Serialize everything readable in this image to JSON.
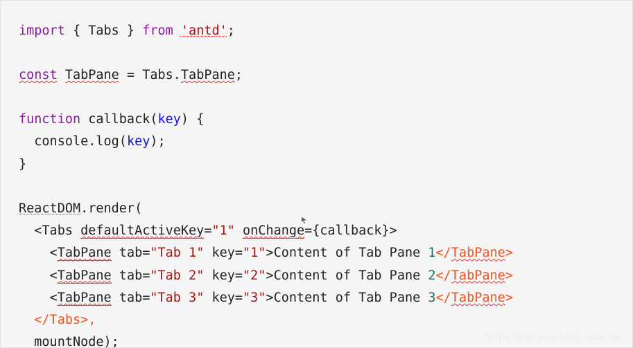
{
  "editor": {
    "background_color": "#f5f5f5",
    "border_color": "#e0e0e0",
    "font_family_kind": "monospace",
    "colors": {
      "plain": "#222222",
      "keyword": "#8b1a9e",
      "string": "#aa1111",
      "parameter": "#1414d6",
      "closing_tag": "#f4511e",
      "number": "#17705e",
      "spellcheck_squiggle": "#e03030",
      "watermark": "#ececec"
    },
    "language": "jsx"
  },
  "code": {
    "full_text": "import { Tabs } from 'antd';\n\nconst TabPane = Tabs.TabPane;\n\nfunction callback(key) {\n  console.log(key);\n}\n\nReactDOM.render(\n  <Tabs defaultActiveKey=\"1\" onChange={callback}>\n    <TabPane tab=\"Tab 1\" key=\"1\">Content of Tab Pane 1</TabPane>\n    <TabPane tab=\"Tab 2\" key=\"2\">Content of Tab Pane 2</TabPane>\n    <TabPane tab=\"Tab 3\" key=\"3\">Content of Tab Pane 3</TabPane>\n  </Tabs>,\n  mountNode);",
    "lines": [
      {
        "n": 1,
        "tokens": [
          {
            "t": "import",
            "c": "keyword"
          },
          {
            "t": " { Tabs } ",
            "c": "plain"
          },
          {
            "t": "from",
            "c": "keyword"
          },
          {
            "t": " ",
            "c": "plain"
          },
          {
            "t": "'antd'",
            "c": "string",
            "u": "dotted"
          },
          {
            "t": ";",
            "c": "plain"
          }
        ]
      },
      {
        "n": 2,
        "tokens": []
      },
      {
        "n": 3,
        "tokens": [
          {
            "t": "const",
            "c": "keyword",
            "u": "wavy"
          },
          {
            "t": " ",
            "c": "plain"
          },
          {
            "t": "TabPane",
            "c": "plain",
            "u": "wavy"
          },
          {
            "t": " = Tabs.",
            "c": "plain"
          },
          {
            "t": "TabPane",
            "c": "plain",
            "u": "wavy"
          },
          {
            "t": ";",
            "c": "plain"
          }
        ]
      },
      {
        "n": 4,
        "tokens": []
      },
      {
        "n": 5,
        "tokens": [
          {
            "t": "function",
            "c": "keyword"
          },
          {
            "t": " callback(",
            "c": "plain"
          },
          {
            "t": "key",
            "c": "parameter"
          },
          {
            "t": ") {",
            "c": "plain"
          }
        ]
      },
      {
        "n": 6,
        "tokens": [
          {
            "t": "  console.log(",
            "c": "plain"
          },
          {
            "t": "key",
            "c": "parameter"
          },
          {
            "t": ");",
            "c": "plain"
          }
        ]
      },
      {
        "n": 7,
        "tokens": [
          {
            "t": "}",
            "c": "plain"
          }
        ]
      },
      {
        "n": 8,
        "tokens": []
      },
      {
        "n": 9,
        "tokens": [
          {
            "t": "ReactDOM",
            "c": "plain",
            "u": "dotted"
          },
          {
            "t": ".render(",
            "c": "plain"
          }
        ]
      },
      {
        "n": 10,
        "tokens": [
          {
            "t": "  <Tabs ",
            "c": "plain"
          },
          {
            "t": "defaultActiveKey",
            "c": "plain",
            "u": "both"
          },
          {
            "t": "=",
            "c": "plain"
          },
          {
            "t": "\"1\"",
            "c": "string"
          },
          {
            "t": " ",
            "c": "plain"
          },
          {
            "t": "onChange",
            "c": "plain",
            "u": "both"
          },
          {
            "t": "={callback}>",
            "c": "plain"
          }
        ]
      },
      {
        "n": 11,
        "tokens": [
          {
            "t": "    <",
            "c": "plain"
          },
          {
            "t": "TabPane",
            "c": "plain",
            "u": "both"
          },
          {
            "t": " tab=",
            "c": "plain"
          },
          {
            "t": "\"Tab 1\"",
            "c": "string"
          },
          {
            "t": " key=",
            "c": "plain"
          },
          {
            "t": "\"1\"",
            "c": "string"
          },
          {
            "t": ">Content of Tab Pane ",
            "c": "plain"
          },
          {
            "t": "1",
            "c": "number"
          },
          {
            "t": "</",
            "c": "closing_tag"
          },
          {
            "t": "TabPane",
            "c": "closing_tag",
            "u": "wavy"
          },
          {
            "t": ">",
            "c": "closing_tag"
          }
        ]
      },
      {
        "n": 12,
        "tokens": [
          {
            "t": "    <",
            "c": "plain"
          },
          {
            "t": "TabPane",
            "c": "plain",
            "u": "both"
          },
          {
            "t": " tab=",
            "c": "plain"
          },
          {
            "t": "\"Tab 2\"",
            "c": "string"
          },
          {
            "t": " key=",
            "c": "plain"
          },
          {
            "t": "\"2\"",
            "c": "string"
          },
          {
            "t": ">Content of Tab Pane ",
            "c": "plain"
          },
          {
            "t": "2",
            "c": "number"
          },
          {
            "t": "</",
            "c": "closing_tag"
          },
          {
            "t": "TabPane",
            "c": "closing_tag",
            "u": "wavy"
          },
          {
            "t": ">",
            "c": "closing_tag"
          }
        ]
      },
      {
        "n": 13,
        "tokens": [
          {
            "t": "    <",
            "c": "plain"
          },
          {
            "t": "TabPane",
            "c": "plain",
            "u": "both"
          },
          {
            "t": " tab=",
            "c": "plain"
          },
          {
            "t": "\"Tab 3\"",
            "c": "string"
          },
          {
            "t": " key=",
            "c": "plain"
          },
          {
            "t": "\"3\"",
            "c": "string"
          },
          {
            "t": ">Content of Tab Pane ",
            "c": "plain"
          },
          {
            "t": "3",
            "c": "number"
          },
          {
            "t": "</",
            "c": "closing_tag"
          },
          {
            "t": "TabPane",
            "c": "closing_tag",
            "u": "wavy"
          },
          {
            "t": ">",
            "c": "closing_tag"
          }
        ]
      },
      {
        "n": 14,
        "tokens": [
          {
            "t": "  ",
            "c": "plain"
          },
          {
            "t": "</Tabs>,",
            "c": "closing_tag"
          }
        ]
      },
      {
        "n": 15,
        "tokens": [
          {
            "t": "  ",
            "c": "plain"
          },
          {
            "t": "mountNode",
            "c": "plain",
            "u": "both"
          },
          {
            "t": ");",
            "c": "plain"
          }
        ]
      }
    ]
  },
  "watermark": {
    "text": "https://cwl-java.blog.csdn.net"
  }
}
